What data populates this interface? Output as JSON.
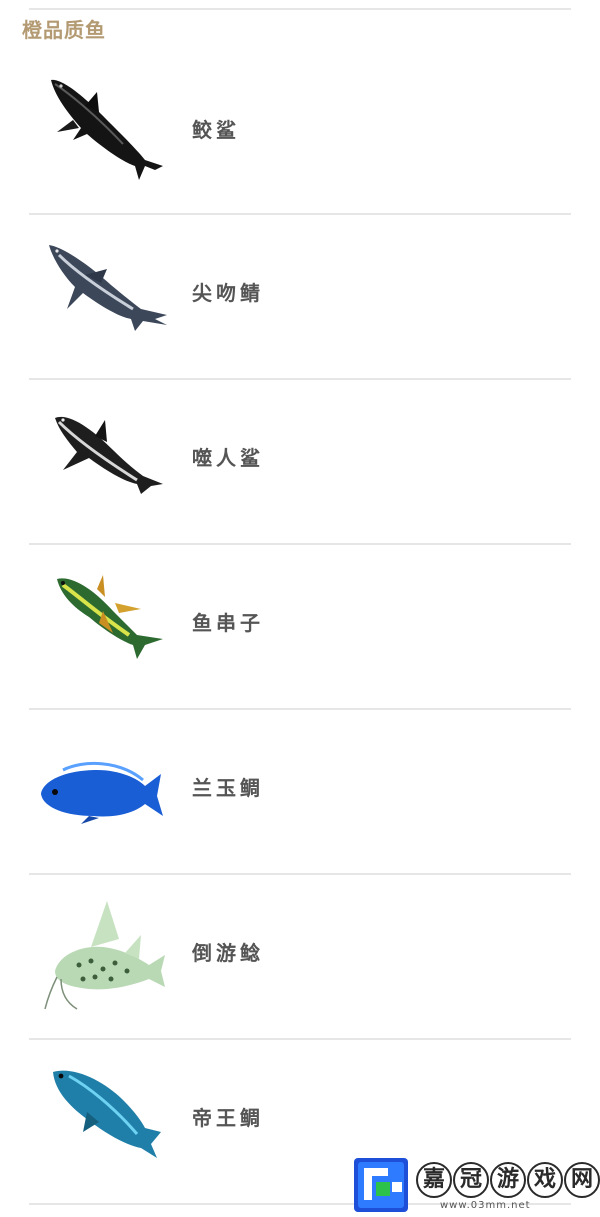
{
  "section": {
    "title": "橙品质鱼"
  },
  "fish": [
    {
      "name": "鲛鲨",
      "icon": "mako-shark-icon",
      "color": "#1c1c1c"
    },
    {
      "name": "尖吻鲭",
      "icon": "shortfin-shark-icon",
      "color": "#3e4a5c"
    },
    {
      "name": "噬人鲨",
      "icon": "great-white-shark-icon",
      "color": "#262626"
    },
    {
      "name": "鱼串子",
      "icon": "yellowfin-tuna-icon",
      "color": "#2b6a2f"
    },
    {
      "name": "兰玉鲷",
      "icon": "blue-cichlid-icon",
      "color": "#1a5ed6"
    },
    {
      "name": "倒游鲶",
      "icon": "spotted-catfish-icon",
      "color": "#9fc79a"
    },
    {
      "name": "帝王鲷",
      "icon": "emperor-cichlid-icon",
      "color": "#1f7fa8"
    }
  ],
  "watermark": {
    "chars": [
      "嘉",
      "冠",
      "游",
      "戏",
      "网"
    ],
    "url": "www.03mm.net"
  }
}
